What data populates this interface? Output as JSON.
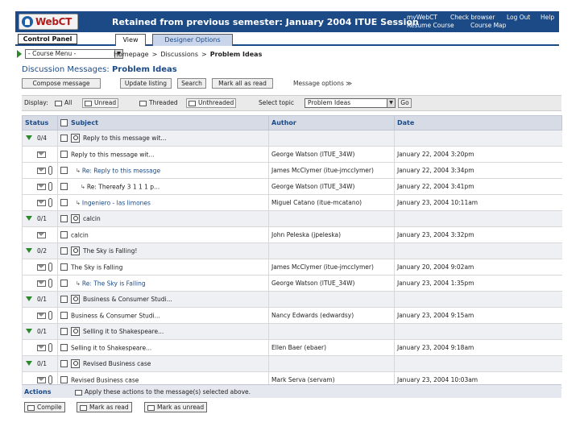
{
  "app": {
    "logo_text": "WebCT",
    "title": "Retained from previous semester: January 2004 ITUE Session"
  },
  "top_links": [
    "myWebCT",
    "Check browser",
    "Log Out",
    "Help",
    "Resume Course",
    "Course Map"
  ],
  "tabs": {
    "control_panel": "Control Panel",
    "view": "View",
    "designer": "Designer Options"
  },
  "course_menu": {
    "selected": "- Course Menu -"
  },
  "breadcrumb": {
    "home": "Homepage",
    "discussions": "Discussions",
    "current": "Problem Ideas",
    "separator": ">"
  },
  "page": {
    "title_prefix": "Discussion Messages:",
    "title_topic": "Problem Ideas"
  },
  "toolbar": {
    "compose": "Compose message",
    "update": "Update listing",
    "search": "Search",
    "mark_all": "Mark all as read",
    "options": "Message options ≫"
  },
  "filter": {
    "display_label": "Display:",
    "all": "All",
    "unread": "Unread",
    "threaded": "Threaded",
    "unthreaded": "Unthreaded",
    "select_topic_label": "Select topic",
    "topic_value": "Problem Ideas",
    "go": "Go"
  },
  "table": {
    "headers": {
      "status": "Status",
      "subject": "Subject",
      "author": "Author",
      "date": "Date"
    },
    "rows": [
      {
        "type": "thread",
        "count": "0/4",
        "subject": "Reply to this message wit...",
        "author": "",
        "date": ""
      },
      {
        "type": "msg",
        "clip": false,
        "indent": 0,
        "subject": "Reply to this message wit...",
        "author": "George Watson (ITUE_34W)",
        "date": "January 22, 2004 3:20pm",
        "link": false
      },
      {
        "type": "msg",
        "clip": true,
        "indent": 1,
        "subject": "Re: Reply to this message",
        "author": "James McClymer (itue-jmcclymer)",
        "date": "January 22, 2004 3:34pm",
        "link": true
      },
      {
        "type": "msg",
        "clip": true,
        "indent": 2,
        "subject": "Re: Thereafy 3 1 1 1 p...",
        "author": "George Watson (ITUE_34W)",
        "date": "January 22, 2004 3:41pm",
        "link": false
      },
      {
        "type": "msg",
        "clip": true,
        "indent": 1,
        "subject": "Ingeniero - las limones",
        "author": "Miguel Catano (itue-mcatano)",
        "date": "January 23, 2004 10:11am",
        "link": true
      },
      {
        "type": "thread",
        "count": "0/1",
        "subject": "calcin",
        "author": "",
        "date": ""
      },
      {
        "type": "msg",
        "clip": false,
        "indent": 0,
        "subject": "calcin",
        "author": "John Peleska (jpeleska)",
        "date": "January 23, 2004 3:32pm",
        "link": false
      },
      {
        "type": "thread",
        "count": "0/2",
        "subject": "The Sky is Falling!",
        "author": "",
        "date": ""
      },
      {
        "type": "msg",
        "clip": true,
        "indent": 0,
        "subject": "The Sky is Falling",
        "author": "James McClymer (itue-jmcclymer)",
        "date": "January 20, 2004 9:02am",
        "link": false
      },
      {
        "type": "msg",
        "clip": true,
        "indent": 1,
        "subject": "Re: The Sky is Falling",
        "author": "George Watson (ITUE_34W)",
        "date": "January 23, 2004 1:35pm",
        "link": true
      },
      {
        "type": "thread",
        "count": "0/1",
        "subject": "Business & Consumer Studi...",
        "author": "",
        "date": ""
      },
      {
        "type": "msg",
        "clip": true,
        "indent": 0,
        "subject": "Business & Consumer Studi...",
        "author": "Nancy Edwards (edwardsy)",
        "date": "January 23, 2004 9:15am",
        "link": false
      },
      {
        "type": "thread",
        "count": "0/1",
        "subject": "Selling it to Shakespeare...",
        "author": "",
        "date": ""
      },
      {
        "type": "msg",
        "clip": true,
        "indent": 0,
        "subject": "Selling it to Shakespeare...",
        "author": "Ellen Baer (ebaer)",
        "date": "January 23, 2004 9:18am",
        "link": false
      },
      {
        "type": "thread",
        "count": "0/1",
        "subject": "Revised Business case",
        "author": "",
        "date": ""
      },
      {
        "type": "msg",
        "clip": true,
        "indent": 0,
        "subject": "Revised Business case",
        "author": "Mark Serva (servam)",
        "date": "January 23, 2004 10:03am",
        "link": false
      }
    ]
  },
  "actions": {
    "label": "Actions",
    "text": "Apply these actions to the message(s) selected above.",
    "compile": "Compile",
    "mark_read": "Mark as read",
    "mark_unread": "Mark as unread"
  }
}
